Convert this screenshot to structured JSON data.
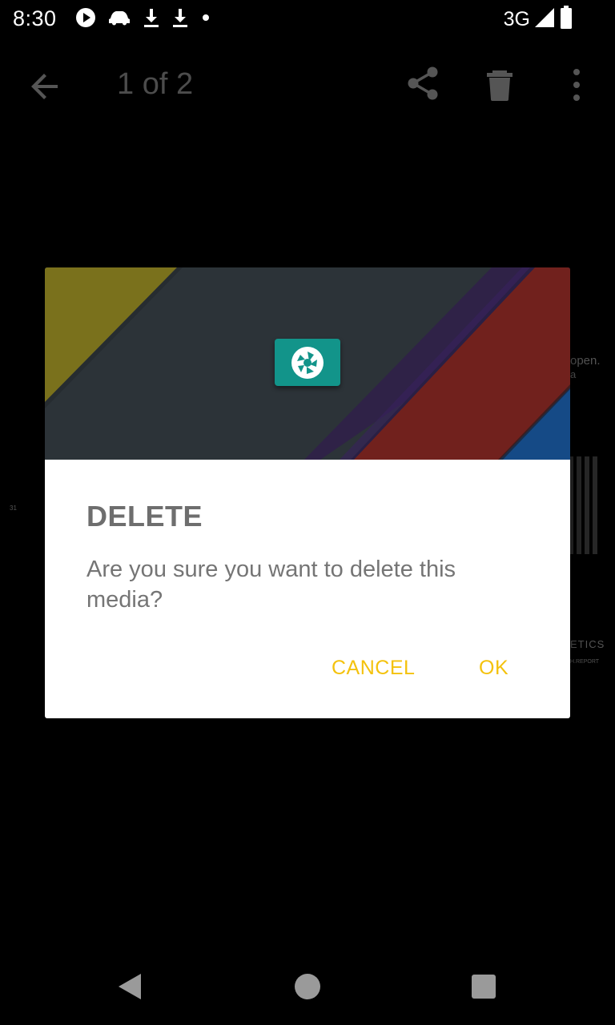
{
  "status_bar": {
    "time": "8:30",
    "network": "3G",
    "icons": [
      "play-icon",
      "car-icon",
      "download-icon",
      "download-icon",
      "dot-icon",
      "signal-icon",
      "battery-icon"
    ]
  },
  "toolbar": {
    "title": "1 of 2",
    "icons": [
      "back-arrow-icon",
      "share-icon",
      "trash-icon",
      "more-vert-icon"
    ]
  },
  "background_media": {
    "snippets": [
      "open.",
      "a",
      "31",
      "ETICS",
      "H.REPORT"
    ]
  },
  "dialog": {
    "title": "DELETE",
    "message": "Are you sure you want to delete this media?",
    "cancel_label": "CANCEL",
    "ok_label": "OK",
    "accent_color": "#f4c20d",
    "icon_color": "#12948a"
  },
  "nav_bar": {
    "icons": [
      "nav-back-icon",
      "nav-home-icon",
      "nav-recents-icon"
    ]
  }
}
